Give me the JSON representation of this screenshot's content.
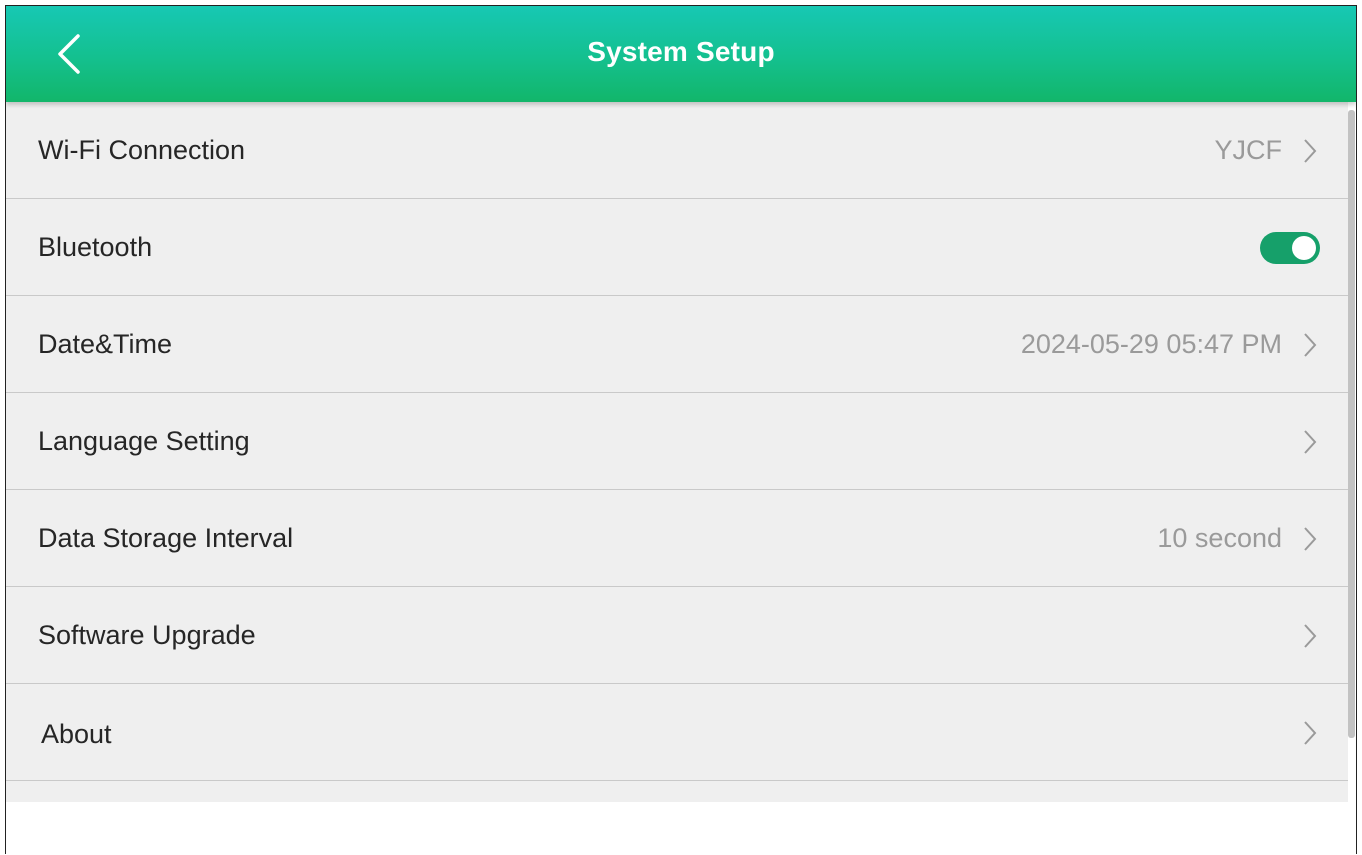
{
  "header": {
    "title": "System Setup",
    "back_icon": "chevron-left-icon",
    "gradient_colors": [
      "#17c8b4",
      "#12b66a"
    ]
  },
  "settings": {
    "items": [
      {
        "label": "Wi-Fi Connection",
        "value": "YJCF",
        "control": "chevron"
      },
      {
        "label": "Bluetooth",
        "value": "",
        "control": "toggle",
        "toggle_on": true
      },
      {
        "label": "Date&Time",
        "value": "2024-05-29 05:47 PM",
        "control": "chevron"
      },
      {
        "label": "Language Setting",
        "value": "",
        "control": "chevron"
      },
      {
        "label": "Data Storage Interval",
        "value": "10 second",
        "control": "chevron"
      },
      {
        "label": "Software Upgrade",
        "value": "",
        "control": "chevron"
      },
      {
        "label": "About",
        "value": "",
        "control": "chevron"
      }
    ]
  },
  "colors": {
    "accent_toggle": "#16a06a",
    "row_background": "#efefef",
    "secondary_text": "#9a9a9a"
  }
}
